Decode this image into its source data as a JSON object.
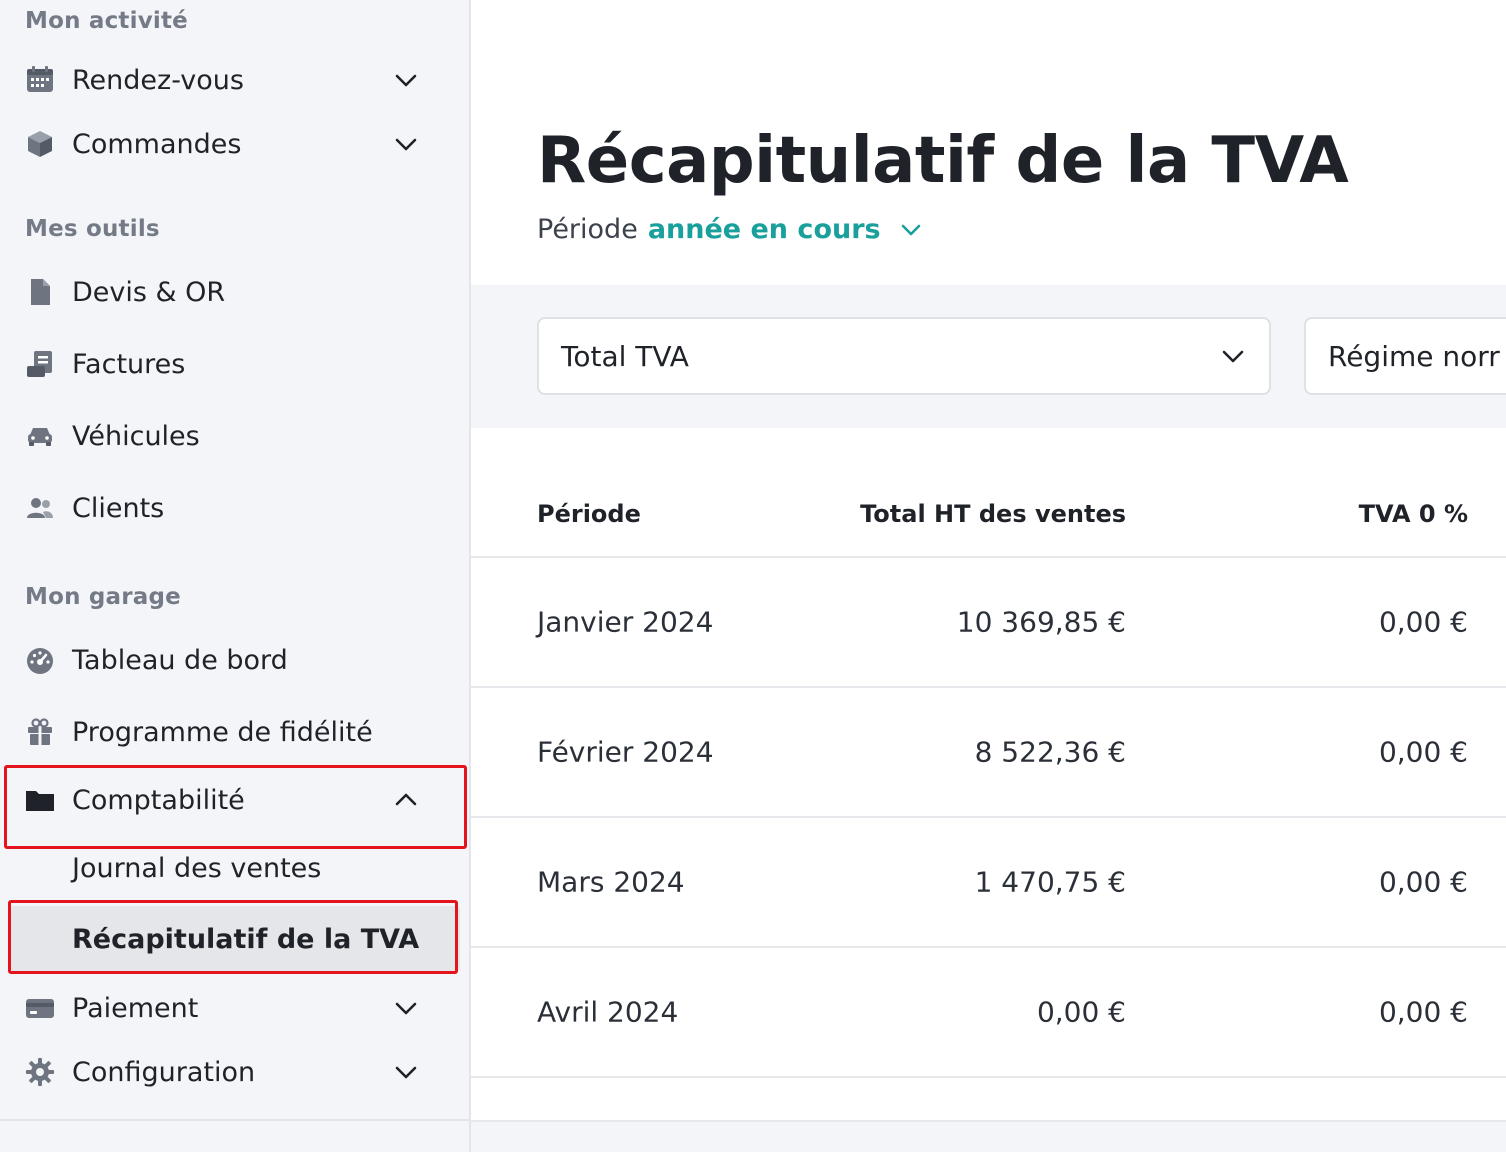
{
  "sidebar": {
    "sections": {
      "activite": "Mon activité",
      "outils": "Mes outils",
      "garage": "Mon garage"
    },
    "items": {
      "rendezvous": "Rendez-vous",
      "commandes": "Commandes",
      "devis": "Devis & OR",
      "factures": "Factures",
      "vehicules": "Véhicules",
      "clients": "Clients",
      "tableau": "Tableau de bord",
      "fidelite": "Programme de fidélité",
      "comptabilite": "Comptabilité",
      "journal": "Journal des ventes",
      "recap": "Récapitulatif de la TVA",
      "paiement": "Paiement",
      "configuration": "Configuration"
    },
    "icons": {
      "rendezvous": "calendar-icon",
      "commandes": "box-icon",
      "devis": "document-icon",
      "factures": "invoice-icon",
      "vehicules": "car-icon",
      "clients": "users-icon",
      "tableau": "gauge-icon",
      "fidelite": "gift-icon",
      "comptabilite": "folder-icon",
      "paiement": "credit-card-icon",
      "configuration": "gear-icon"
    },
    "active_item": "recap",
    "highlight_color": "#e3141b"
  },
  "main": {
    "title": "Récapitulatif de la TVA",
    "period_label": "Période",
    "period_value": "année en cours",
    "accent_color": "#1aa09c",
    "filters": {
      "type": "Total TVA",
      "regime": "Régime norr"
    },
    "table": {
      "headers": {
        "periode": "Période",
        "ht": "Total HT des ventes",
        "tva0": "TVA 0 %"
      },
      "rows": [
        {
          "periode": "Janvier 2024",
          "ht": "10 369,85 €",
          "tva0": "0,00 €"
        },
        {
          "periode": "Février 2024",
          "ht": "8 522,36 €",
          "tva0": "0,00 €"
        },
        {
          "periode": "Mars 2024",
          "ht": "1 470,75 €",
          "tva0": "0,00 €"
        },
        {
          "periode": "Avril 2024",
          "ht": "0,00 €",
          "tva0": "0,00 €"
        }
      ]
    }
  }
}
